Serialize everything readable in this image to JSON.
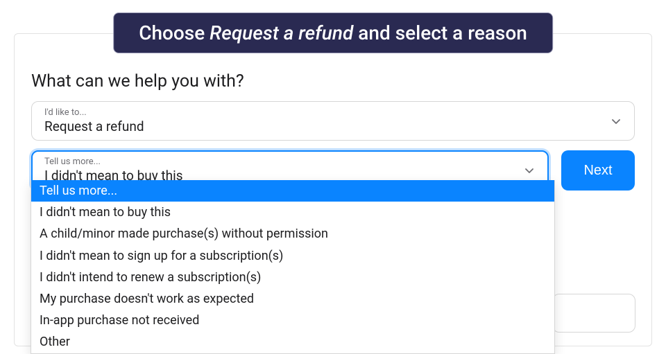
{
  "banner": {
    "pre": "Choose ",
    "italic": "Request a refund",
    "post": " and select a reason"
  },
  "form": {
    "heading": "What can we help you with?",
    "select1": {
      "label": "I'd like to...",
      "value": "Request a refund"
    },
    "select2": {
      "label": "Tell us more...",
      "value": "I didn't mean to buy this"
    },
    "next_label": "Next"
  },
  "dropdown": {
    "options": [
      "Tell us more...",
      "I didn't mean to buy this",
      "A child/minor made purchase(s) without permission",
      "I didn't mean to sign up for a subscription(s)",
      "I didn't intend to renew a subscription(s)",
      "My purchase doesn't work as expected",
      "In-app purchase not received",
      "Other"
    ],
    "highlighted_index": 0
  },
  "colors": {
    "accent": "#0a84ff",
    "banner_bg": "#2a2a52"
  }
}
